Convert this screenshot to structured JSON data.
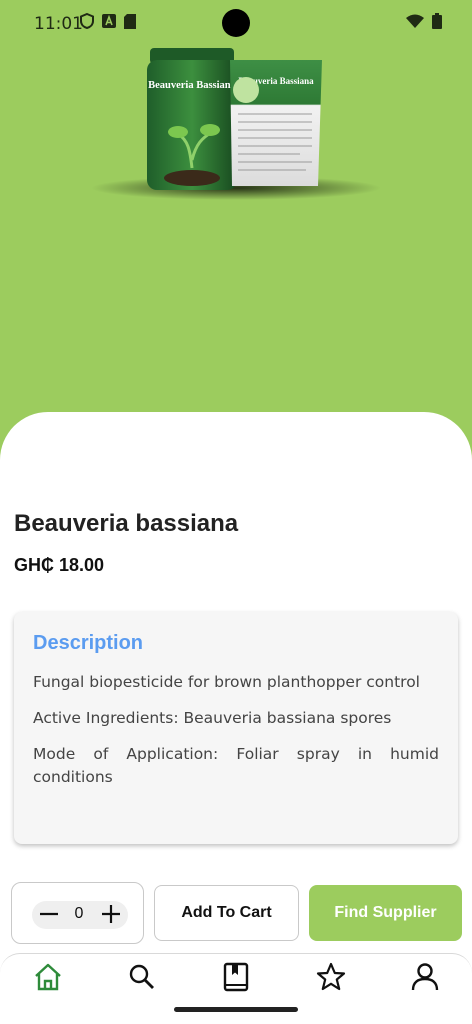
{
  "status_bar": {
    "time": "11:01",
    "left_icons": [
      "shield-icon",
      "a-icon",
      "sd-card-icon"
    ],
    "right_icons": [
      "wifi-icon",
      "battery-icon"
    ]
  },
  "hero": {
    "bottle_label": "Beauveria Bassiana",
    "pouch_label": "Beauveria Bassiana"
  },
  "product": {
    "name": "Beauveria bassiana",
    "price": "GH₵ 18.00"
  },
  "description": {
    "heading": "Description",
    "lines": [
      "Fungal biopesticide for brown planthopper control",
      "Active Ingredients: Beauveria bassiana spores",
      "Mode of Application: Foliar spray in humid conditions"
    ]
  },
  "actions": {
    "quantity": "0",
    "add_to_cart": "Add To Cart",
    "find_supplier": "Find Supplier"
  },
  "nav": {
    "items": [
      "home-icon",
      "search-icon",
      "book-icon",
      "star-icon",
      "profile-icon"
    ],
    "active": "home-icon"
  },
  "colors": {
    "brand_green": "#9ccc5e",
    "active_nav": "#2e8b3a",
    "description_heading": "#5b9cf0"
  }
}
